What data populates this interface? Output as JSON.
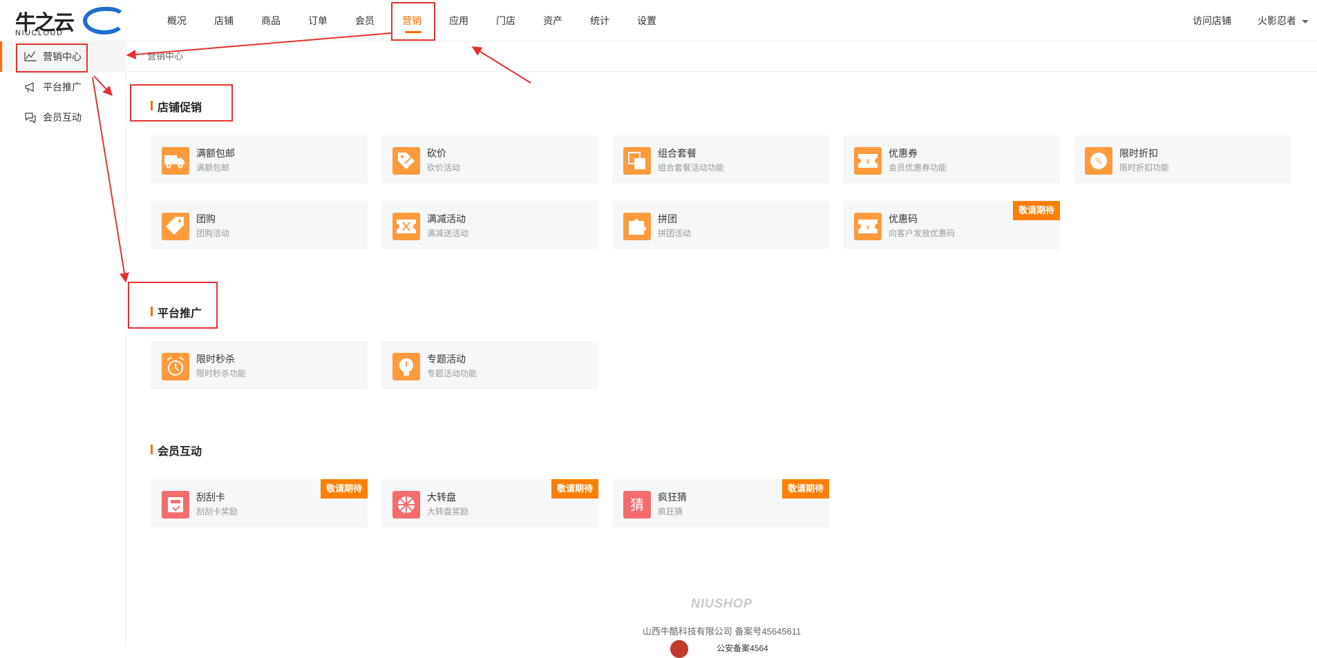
{
  "brand": {
    "logo_text": "牛之云",
    "logo_sub": "NIUCLOUD"
  },
  "nav": [
    "概况",
    "店铺",
    "商品",
    "订单",
    "会员",
    "营销",
    "应用",
    "门店",
    "资产",
    "统计",
    "设置"
  ],
  "nav_active": "营销",
  "top_right": {
    "visit_store": "访问店铺",
    "user": "火影忍者"
  },
  "sidebar": [
    {
      "label": "营销中心",
      "icon": "chart-line-icon"
    },
    {
      "label": "平台推广",
      "icon": "megaphone-icon"
    },
    {
      "label": "会员互动",
      "icon": "chat-icon"
    }
  ],
  "breadcrumb": "营销中心",
  "sections": [
    {
      "title": "店铺促销",
      "cards": [
        {
          "title": "满额包邮",
          "desc": "满额包邮",
          "icon": "truck-icon",
          "color": "#ff9b3d",
          "badge": ""
        },
        {
          "title": "砍价",
          "desc": "砍价活动",
          "icon": "tag-cut-icon",
          "color": "#ff9b3d",
          "badge": ""
        },
        {
          "title": "组合套餐",
          "desc": "组合套餐活动功能",
          "icon": "combo-icon",
          "color": "#ff9b3d",
          "badge": ""
        },
        {
          "title": "优惠券",
          "desc": "会员优惠券功能",
          "icon": "coupon-icon",
          "color": "#ff9b3d",
          "badge": ""
        },
        {
          "title": "限时折扣",
          "desc": "限时折扣功能",
          "icon": "percent-icon",
          "color": "#ff9b3d",
          "badge": ""
        },
        {
          "title": "团购",
          "desc": "团购活动",
          "icon": "price-tag-icon",
          "color": "#ff9b3d",
          "badge": ""
        },
        {
          "title": "满减活动",
          "desc": "满减送活动",
          "icon": "ticket-icon",
          "color": "#ff9b3d",
          "badge": ""
        },
        {
          "title": "拼团",
          "desc": "拼团活动",
          "icon": "puzzle-icon",
          "color": "#ff9b3d",
          "badge": ""
        },
        {
          "title": "优惠码",
          "desc": "向客户发放优惠码",
          "icon": "coupon-code-icon",
          "color": "#ff9b3d",
          "badge": "敬请期待"
        }
      ]
    },
    {
      "title": "平台推广",
      "cards": [
        {
          "title": "限时秒杀",
          "desc": "限时秒杀功能",
          "icon": "alarm-clock-icon",
          "color": "#ff9b3d",
          "badge": ""
        },
        {
          "title": "专题活动",
          "desc": "专题活动功能",
          "icon": "lightbulb-icon",
          "color": "#ff9b3d",
          "badge": ""
        }
      ]
    },
    {
      "title": "会员互动",
      "cards": [
        {
          "title": "刮刮卡",
          "desc": "刮刮卡奖励",
          "icon": "scratch-card-icon",
          "color": "#f56c6c",
          "badge": "敬请期待"
        },
        {
          "title": "大转盘",
          "desc": "大转盘奖励",
          "icon": "wheel-icon",
          "color": "#f56c6c",
          "badge": "敬请期待"
        },
        {
          "title": "疯狂猜",
          "desc": "疯狂猜",
          "icon": "guess-icon",
          "color": "#f56c6c",
          "badge": "敬请期待",
          "icon_glyph": "猜"
        }
      ]
    }
  ],
  "footer": {
    "logo": "NIUSHOP",
    "company": "山西牛酷科技有限公司  备案号45645611",
    "police": "公安备案4564"
  },
  "colors": {
    "accent": "#ff6a00",
    "badge": "#ff7f00",
    "annotation": "#e6312f"
  }
}
